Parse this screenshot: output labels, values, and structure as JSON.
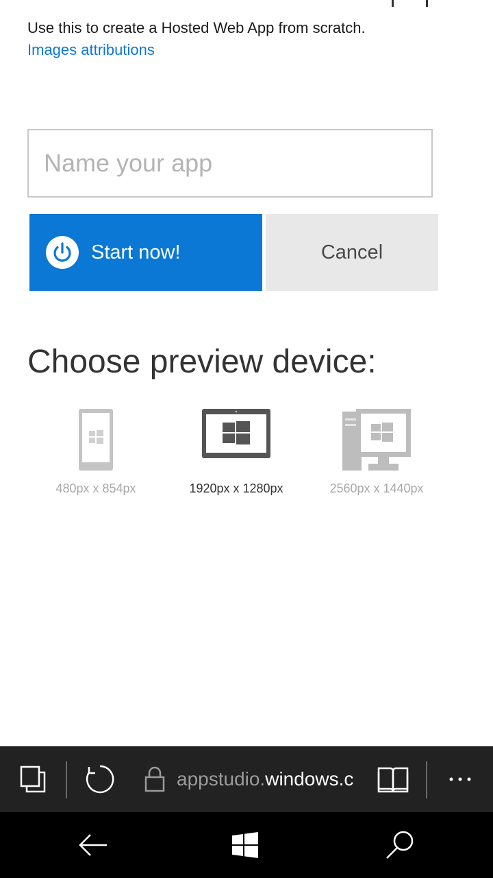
{
  "page": {
    "description": "Use this to create a Hosted Web App from scratch.",
    "attributions_link": "Images attributions"
  },
  "form": {
    "name_placeholder": "Name your app",
    "name_value": "",
    "start_label": "Start now!",
    "cancel_label": "Cancel"
  },
  "preview": {
    "heading": "Choose preview device:",
    "devices": [
      {
        "icon": "phone-icon",
        "label": "480px x 854px",
        "selected": false
      },
      {
        "icon": "tablet-icon",
        "label": "1920px x 1280px",
        "selected": true
      },
      {
        "icon": "desktop-icon",
        "label": "2560px x 1440px",
        "selected": false
      }
    ]
  },
  "browser": {
    "url_prefix": "appstudio.",
    "url_domain": "windows.c",
    "icons": [
      "tabs-icon",
      "refresh-icon",
      "lock-icon",
      "reading-view-icon",
      "more-icon"
    ]
  },
  "system_nav": {
    "icons": [
      "back-icon",
      "windows-start-icon",
      "search-icon"
    ]
  },
  "colors": {
    "accent": "#0a78d4",
    "cancel_bg": "#e8e8e8",
    "address_bar_bg": "#222222",
    "nav_bar_bg": "#000000"
  }
}
